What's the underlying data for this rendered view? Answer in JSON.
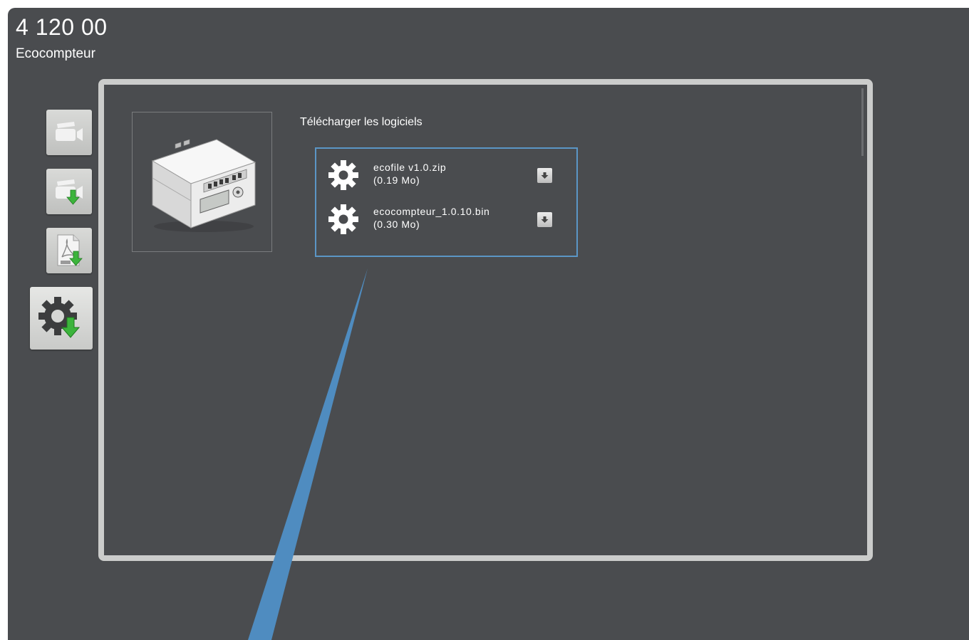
{
  "header": {
    "product_code": "4 120 00",
    "product_name": "Ecocompteur"
  },
  "sidebar": {
    "items": [
      {
        "icon": "video-camera-icon",
        "active": false
      },
      {
        "icon": "video-download-icon",
        "active": false
      },
      {
        "icon": "pdf-download-icon",
        "active": false
      },
      {
        "icon": "software-download-icon",
        "active": true
      }
    ]
  },
  "content": {
    "product_image": "energy-meter-module-image",
    "section_title": "Télécharger les logiciels",
    "files": [
      {
        "name": "ecofile v1.0.zip",
        "size": "(0.19 Mo)",
        "icon": "gear-icon"
      },
      {
        "name": "ecocompteur_1.0.10.bin",
        "size": "(0.30 Mo)",
        "icon": "gear-icon"
      }
    ]
  },
  "colors": {
    "background": "#4a4c4f",
    "frame": "#cbcccb",
    "highlight": "#5b96c6",
    "download_green": "#3cb43c"
  }
}
